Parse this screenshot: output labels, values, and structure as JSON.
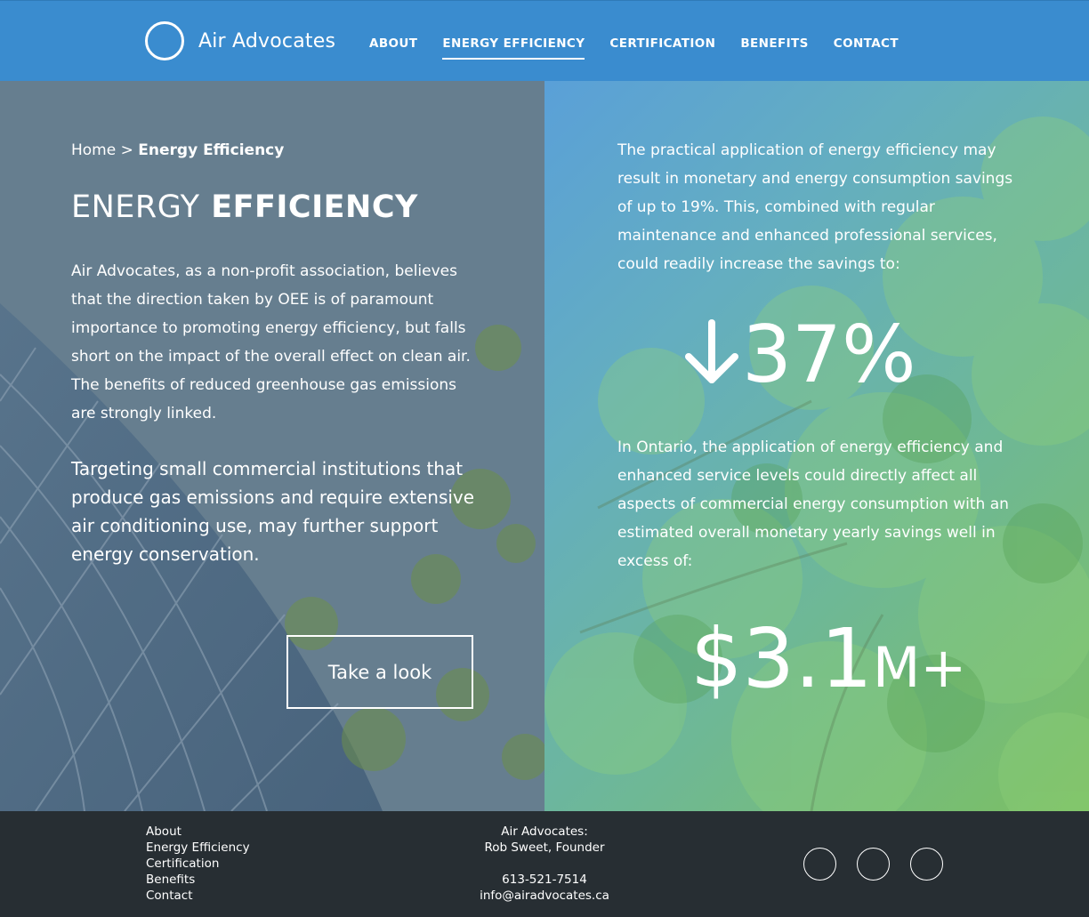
{
  "header": {
    "logo_text": "Air Advocates",
    "nav": [
      {
        "label": "ABOUT"
      },
      {
        "label": "ENERGY EFFICIENCY"
      },
      {
        "label": "CERTIFICATION"
      },
      {
        "label": "BENEFITS"
      },
      {
        "label": "CONTACT"
      }
    ],
    "active_nav": "ENERGY EFFICIENCY"
  },
  "breadcrumb": {
    "home": "Home",
    "separator": ">",
    "current": "Energy Efficiency"
  },
  "left": {
    "title_light": "ENERGY",
    "title_bold": "EFFICIENCY",
    "intro": "Air Advocates, as a non-profit association, believes that the direction taken by OEE is of paramount importance to promoting energy efficiency, but falls short on the impact of the overall effect on clean air. The benefits of reduced greenhouse gas emissions are strongly linked.",
    "emphasis": "Targeting small commercial institutions that produce gas emissions and require extensive air conditioning use, may further support energy conservation.",
    "cta_label": "Take a look"
  },
  "right": {
    "p1": "The practical application of energy efficiency may result in monetary and energy consumption savings of up to 19%. This, combined with regular maintenance and enhanced professional services, could readily increase the savings to:",
    "stat1_value": "37%",
    "stat1_icon": "arrow-down-icon",
    "p2": "In Ontario, the application of energy efficiency and enhanced service levels could directly affect all aspects of commercial energy consumption with an estimated overall monetary yearly savings well in excess of:",
    "stat2_value": "$3.1",
    "stat2_suffix": "M+"
  },
  "footer": {
    "links": [
      {
        "label": "About"
      },
      {
        "label": "Energy Efficiency"
      },
      {
        "label": "Certification"
      },
      {
        "label": "Benefits"
      },
      {
        "label": "Contact"
      }
    ],
    "contact": {
      "org": "Air Advocates:",
      "person": "Rob Sweet, Founder",
      "phone": "613-521-7514",
      "email": "info@airadvocates.ca"
    },
    "socials": [
      "social-icon",
      "social-icon",
      "social-icon"
    ]
  },
  "colors": {
    "header": "#3a8ccf",
    "footer": "#272e33",
    "left_panel": "#667e8f",
    "right_gradient_start": "#5aa0d8",
    "right_gradient_end": "#7cc062"
  }
}
